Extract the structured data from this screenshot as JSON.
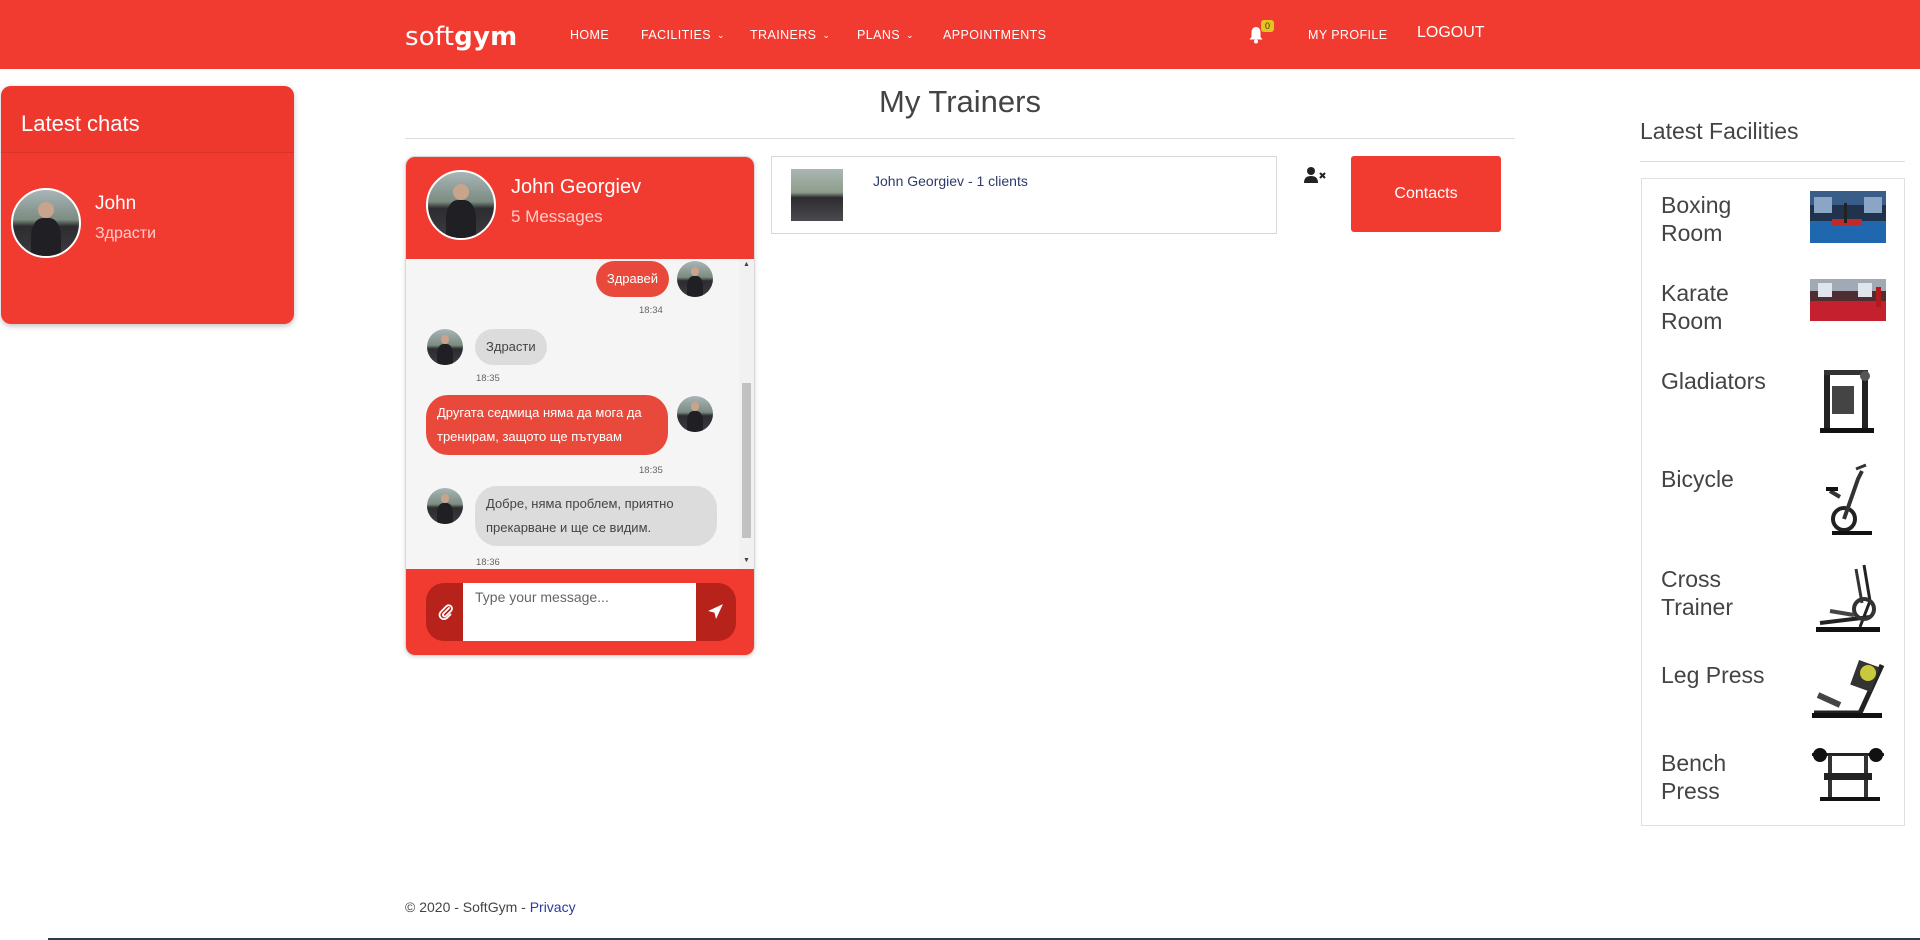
{
  "brand": {
    "light": "soft",
    "bold": "gym"
  },
  "nav": {
    "home": "HOME",
    "facilities": "FACILITIES",
    "trainers": "TRAINERS",
    "plans": "PLANS",
    "appointments": "APPOINTMENTS",
    "notifications_count": "0",
    "my_profile": "MY PROFILE",
    "logout": "LOGOUT"
  },
  "latest_chats": {
    "title": "Latest chats",
    "items": [
      {
        "name": "John",
        "preview": "Здрасти"
      }
    ]
  },
  "page_title": "My Trainers",
  "chat": {
    "name": "John Georgiev",
    "count": "5 Messages",
    "messages": [
      {
        "side": "out",
        "text": "Здравей",
        "time": "18:34"
      },
      {
        "side": "in",
        "text": "Здрасти",
        "time": "18:35"
      },
      {
        "side": "out",
        "text": "Другата седмица няма да мога да тренирам, защото ще пътувам",
        "time": "18:35"
      },
      {
        "side": "in",
        "text": "Добре, няма проблем, приятно прекарване и ще се видим.",
        "time": "18:36"
      }
    ],
    "input_placeholder": "Type your message..."
  },
  "trainer_card": {
    "label": "John Georgiev - 1 clients"
  },
  "contacts_button": "Contacts",
  "facilities": {
    "title": "Latest Facilities",
    "items": [
      {
        "name": "Boxing Room",
        "icon": "boxing-room-photo"
      },
      {
        "name": "Karate Room",
        "icon": "karate-room-photo"
      },
      {
        "name": "Gladiators",
        "icon": "gladiators-machine-photo"
      },
      {
        "name": "Bicycle",
        "icon": "bicycle-machine-photo"
      },
      {
        "name": "Cross Trainer",
        "icon": "cross-trainer-photo"
      },
      {
        "name": "Leg Press",
        "icon": "leg-press-photo"
      },
      {
        "name": "Bench Press",
        "icon": "bench-press-photo"
      }
    ]
  },
  "footer": {
    "copyright": "© 2020 - SoftGym - ",
    "privacy": "Privacy"
  },
  "colors": {
    "primary": "#f13b31",
    "dark_primary": "#b7231b",
    "badge": "#e5c51c",
    "link": "#2d3a9e"
  }
}
